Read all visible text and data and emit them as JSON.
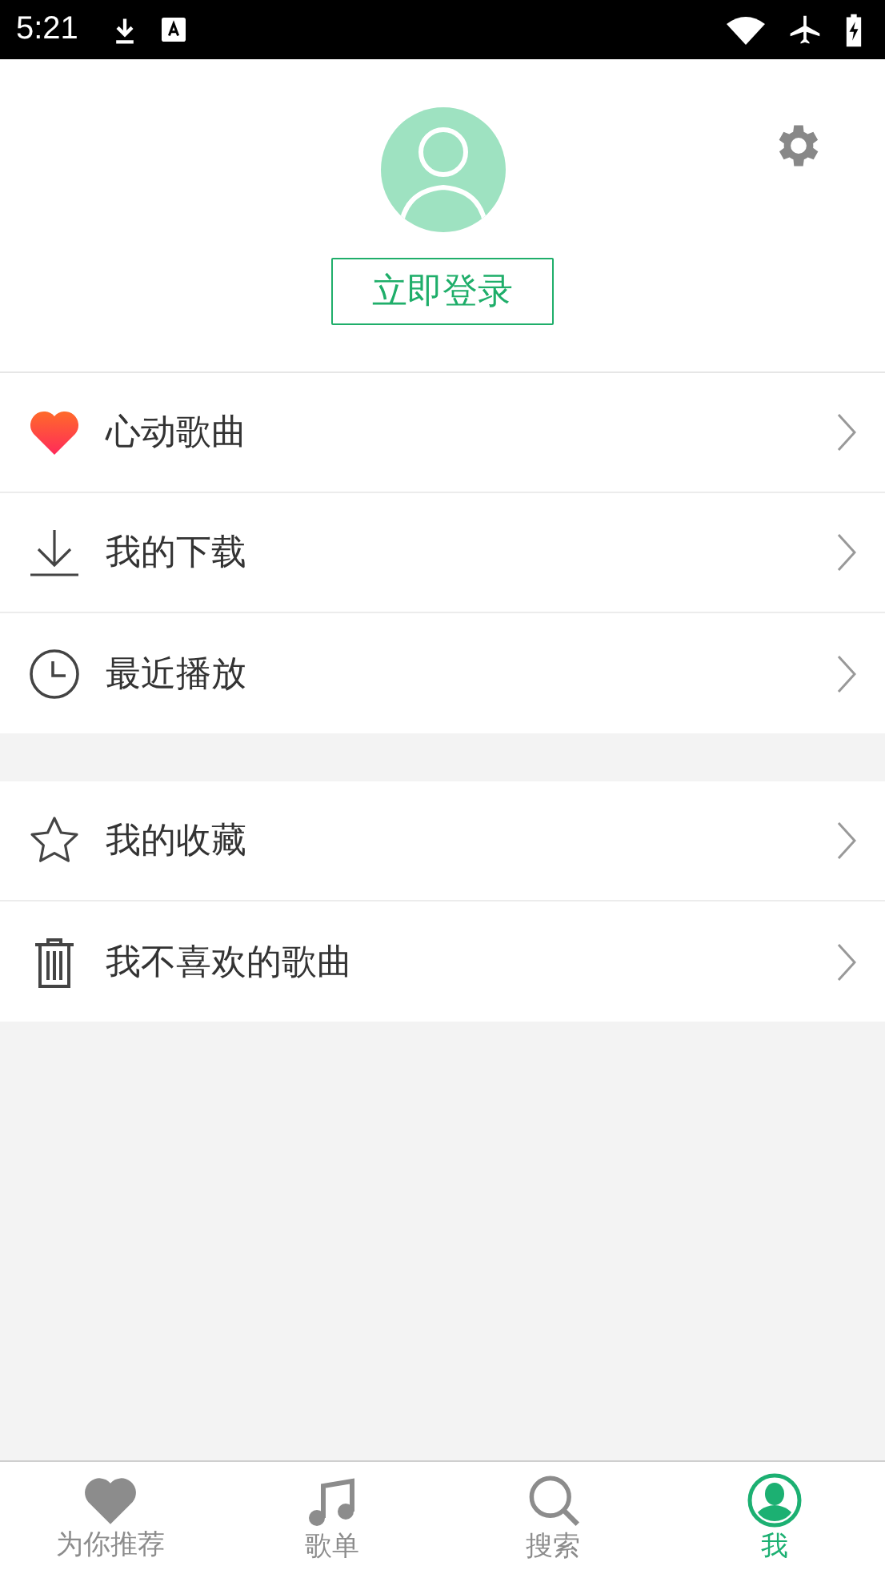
{
  "status_bar": {
    "time": "5:21"
  },
  "profile": {
    "login_button": "立即登录"
  },
  "menu_groups": [
    {
      "items": [
        {
          "kind": "heart",
          "label": "心动歌曲"
        },
        {
          "kind": "download",
          "label": "我的下载"
        },
        {
          "kind": "clock",
          "label": "最近播放"
        }
      ]
    },
    {
      "items": [
        {
          "kind": "star",
          "label": "我的收藏"
        },
        {
          "kind": "trash",
          "label": "我不喜欢的歌曲"
        }
      ]
    }
  ],
  "tabs": [
    {
      "kind": "heart",
      "label": "为你推荐",
      "selected": false
    },
    {
      "kind": "note",
      "label": "歌单",
      "selected": false
    },
    {
      "kind": "search",
      "label": "搜索",
      "selected": false
    },
    {
      "kind": "person",
      "label": "我",
      "selected": true
    }
  ]
}
